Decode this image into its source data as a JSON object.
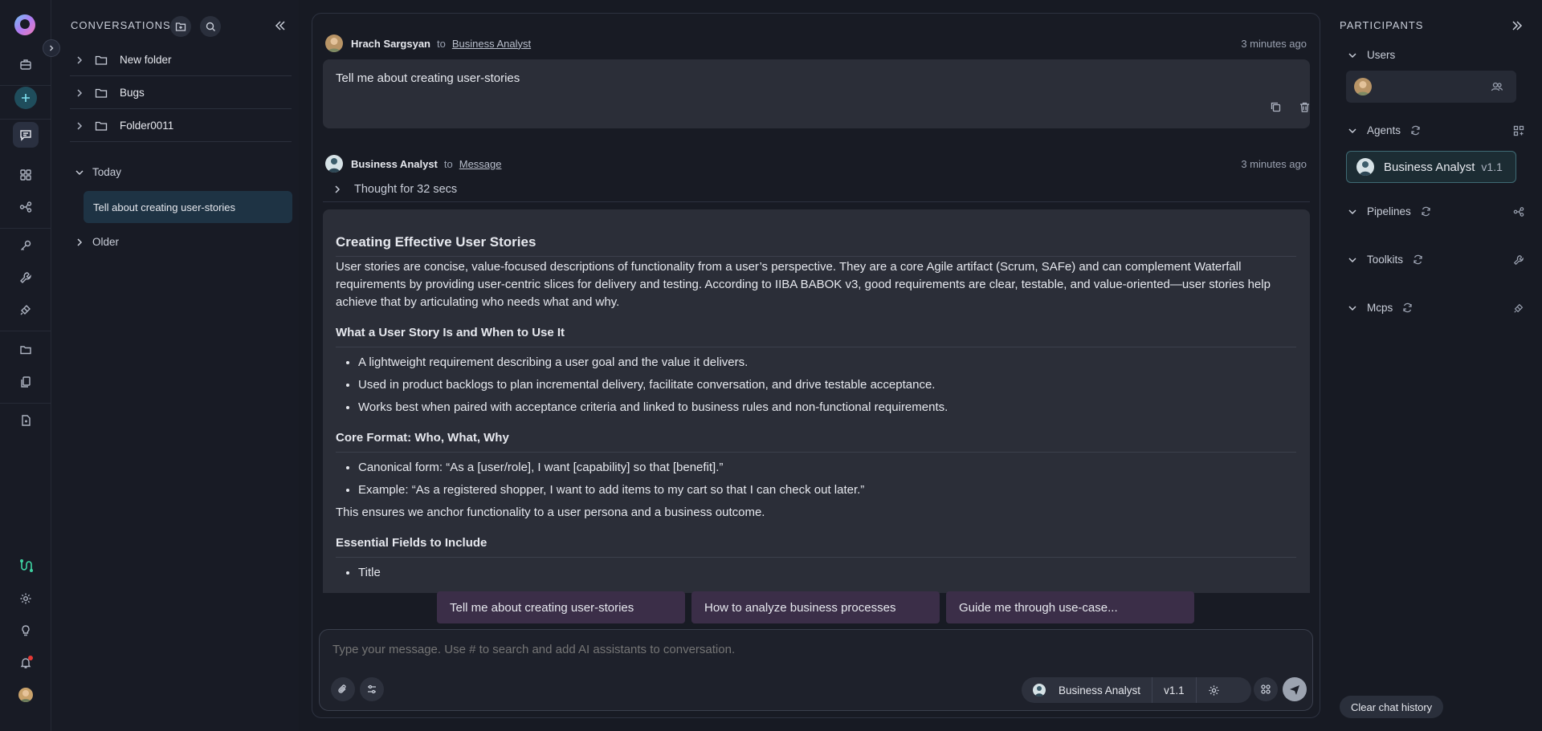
{
  "rail": {
    "notification_dot_color": "#e53935"
  },
  "conversations": {
    "title": "CONVERSATIONS",
    "folders": [
      {
        "label": "New folder"
      },
      {
        "label": "Bugs"
      },
      {
        "label": "Folder0011"
      }
    ],
    "groups": {
      "today": "Today",
      "older": "Older"
    },
    "today_items": [
      "Tell about creating user-stories"
    ]
  },
  "chat": {
    "user_message": {
      "author": "Hrach Sargsyan",
      "to_word": "to",
      "recipient": "Business Analyst",
      "time": "3 minutes ago",
      "text": "Tell me about creating user-stories"
    },
    "agent_message": {
      "author": "Business Analyst",
      "to_word": "to",
      "recipient": "Message",
      "time": "3 minutes ago",
      "thought": "Thought for 32 secs",
      "heading": "Creating Effective User Stories",
      "intro": "User stories are concise, value-focused descriptions of functionality from a user’s perspective. They are a core Agile artifact (Scrum, SAFe) and can complement Waterfall requirements by providing user-centric slices for delivery and testing. According to IIBA BABOK v3, good requirements are clear, testable, and value-oriented—user stories help achieve that by articulating who needs what and why.",
      "section1": {
        "title": "What a User Story Is and When to Use It",
        "bullets": [
          "A lightweight requirement describing a user goal and the value it delivers.",
          "Used in product backlogs to plan incremental delivery, facilitate conversation, and drive testable acceptance.",
          "Works best when paired with acceptance criteria and linked to business rules and non-functional requirements."
        ]
      },
      "section2": {
        "title": "Core Format: Who, What, Why",
        "bullets": [
          "Canonical form: “As a [user/role], I want [capability] so that [benefit].”",
          "Example: “As a registered shopper, I want to add items to my cart so that I can check out later.”"
        ],
        "after": "This ensures we anchor functionality to a user persona and a business outcome."
      },
      "section3": {
        "title": "Essential Fields to Include",
        "bullets": [
          "Title"
        ]
      }
    },
    "suggestions": [
      "Tell me about creating user-stories",
      "How to analyze business processes",
      "Guide me through use-case..."
    ],
    "input": {
      "placeholder": "Type your message. Use # to search and add AI assistants to conversation.",
      "agent_name": "Business Analyst",
      "agent_version": "v1.1"
    }
  },
  "participants": {
    "title": "PARTICIPANTS",
    "sections": {
      "users": "Users",
      "agents": "Agents",
      "pipelines": "Pipelines",
      "toolkits": "Toolkits",
      "mcps": "Mcps"
    },
    "agent_card": {
      "name": "Business Analyst",
      "version": "v1.1"
    },
    "clear_button": "Clear chat history"
  }
}
